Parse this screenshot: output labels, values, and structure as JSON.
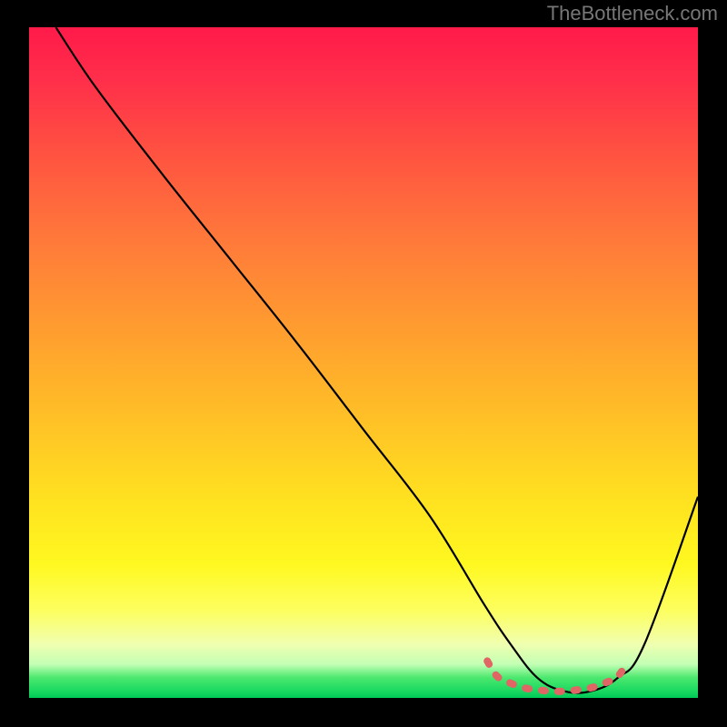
{
  "watermark": "TheBottleneck.com",
  "chart_data": {
    "type": "line",
    "title": "",
    "xlabel": "",
    "ylabel": "",
    "xlim": [
      0,
      100
    ],
    "ylim": [
      0,
      100
    ],
    "grid": false,
    "legend": false,
    "series": [
      {
        "name": "bottleneck-curve",
        "x": [
          4,
          10,
          20,
          30,
          40,
          50,
          60,
          68,
          72,
          76,
          80,
          84,
          88,
          92,
          100
        ],
        "values": [
          100,
          91,
          78,
          65.5,
          53,
          40,
          27,
          14,
          8,
          3,
          1,
          1,
          3,
          8,
          30
        ],
        "color": "#000000"
      },
      {
        "name": "optimal-range-marker",
        "x": [
          68.5,
          70,
          72,
          74,
          76,
          78,
          80,
          82,
          84,
          86,
          88,
          89.5
        ],
        "values": [
          5.5,
          3.2,
          2.2,
          1.5,
          1.2,
          1.0,
          1.0,
          1.2,
          1.5,
          2.2,
          3.2,
          5.5
        ],
        "color": "#e06666"
      }
    ],
    "gradient_stops": [
      {
        "pos": 0,
        "color": "#ff1a4a"
      },
      {
        "pos": 20,
        "color": "#ff5640"
      },
      {
        "pos": 44,
        "color": "#ff9a30"
      },
      {
        "pos": 70,
        "color": "#ffe020"
      },
      {
        "pos": 87,
        "color": "#fdff60"
      },
      {
        "pos": 95,
        "color": "#c2ffb4"
      },
      {
        "pos": 100,
        "color": "#00c858"
      }
    ]
  }
}
